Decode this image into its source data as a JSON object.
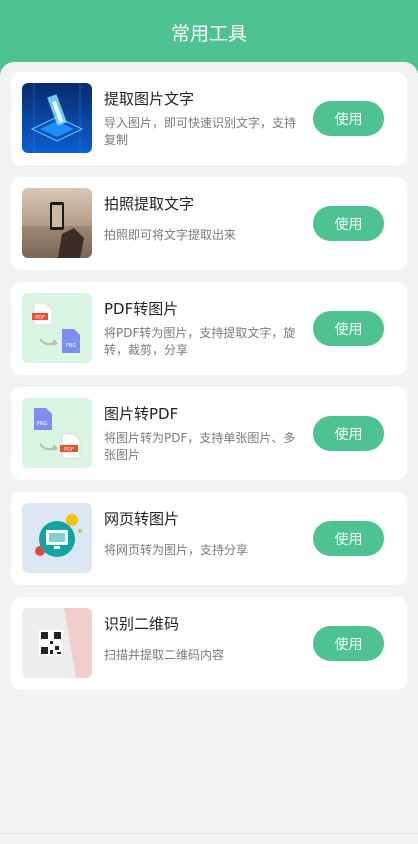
{
  "header": {
    "title": "常用工具"
  },
  "tools": [
    {
      "title": "提取图片文字",
      "desc": "导入图片，即可快速识别文字，支持复制",
      "button": "使用",
      "icon": "ocr-chip-icon"
    },
    {
      "title": "拍照提取文字",
      "desc": "拍照即可将文字提取出来",
      "button": "使用",
      "icon": "camera-photo-icon"
    },
    {
      "title": "PDF转图片",
      "desc": "将PDF转为图片，支持提取文字，旋转，裁剪，分享",
      "button": "使用",
      "icon": "pdf-to-png-icon",
      "icon_labels": [
        "PDF",
        "PNG"
      ]
    },
    {
      "title": "图片转PDF",
      "desc": "将图片转为PDF，支持单张图片、多张图片",
      "button": "使用",
      "icon": "png-to-pdf-icon",
      "icon_labels": [
        "PNG",
        "PDF"
      ]
    },
    {
      "title": "网页转图片",
      "desc": "将网页转为图片，支持分享",
      "button": "使用",
      "icon": "web-to-image-icon"
    },
    {
      "title": "识别二维码",
      "desc": "扫描并提取二维码内容",
      "button": "使用",
      "icon": "qr-scan-icon"
    }
  ],
  "colors": {
    "accent": "#4ec291",
    "background": "#f3f3f3",
    "card": "#ffffff"
  }
}
